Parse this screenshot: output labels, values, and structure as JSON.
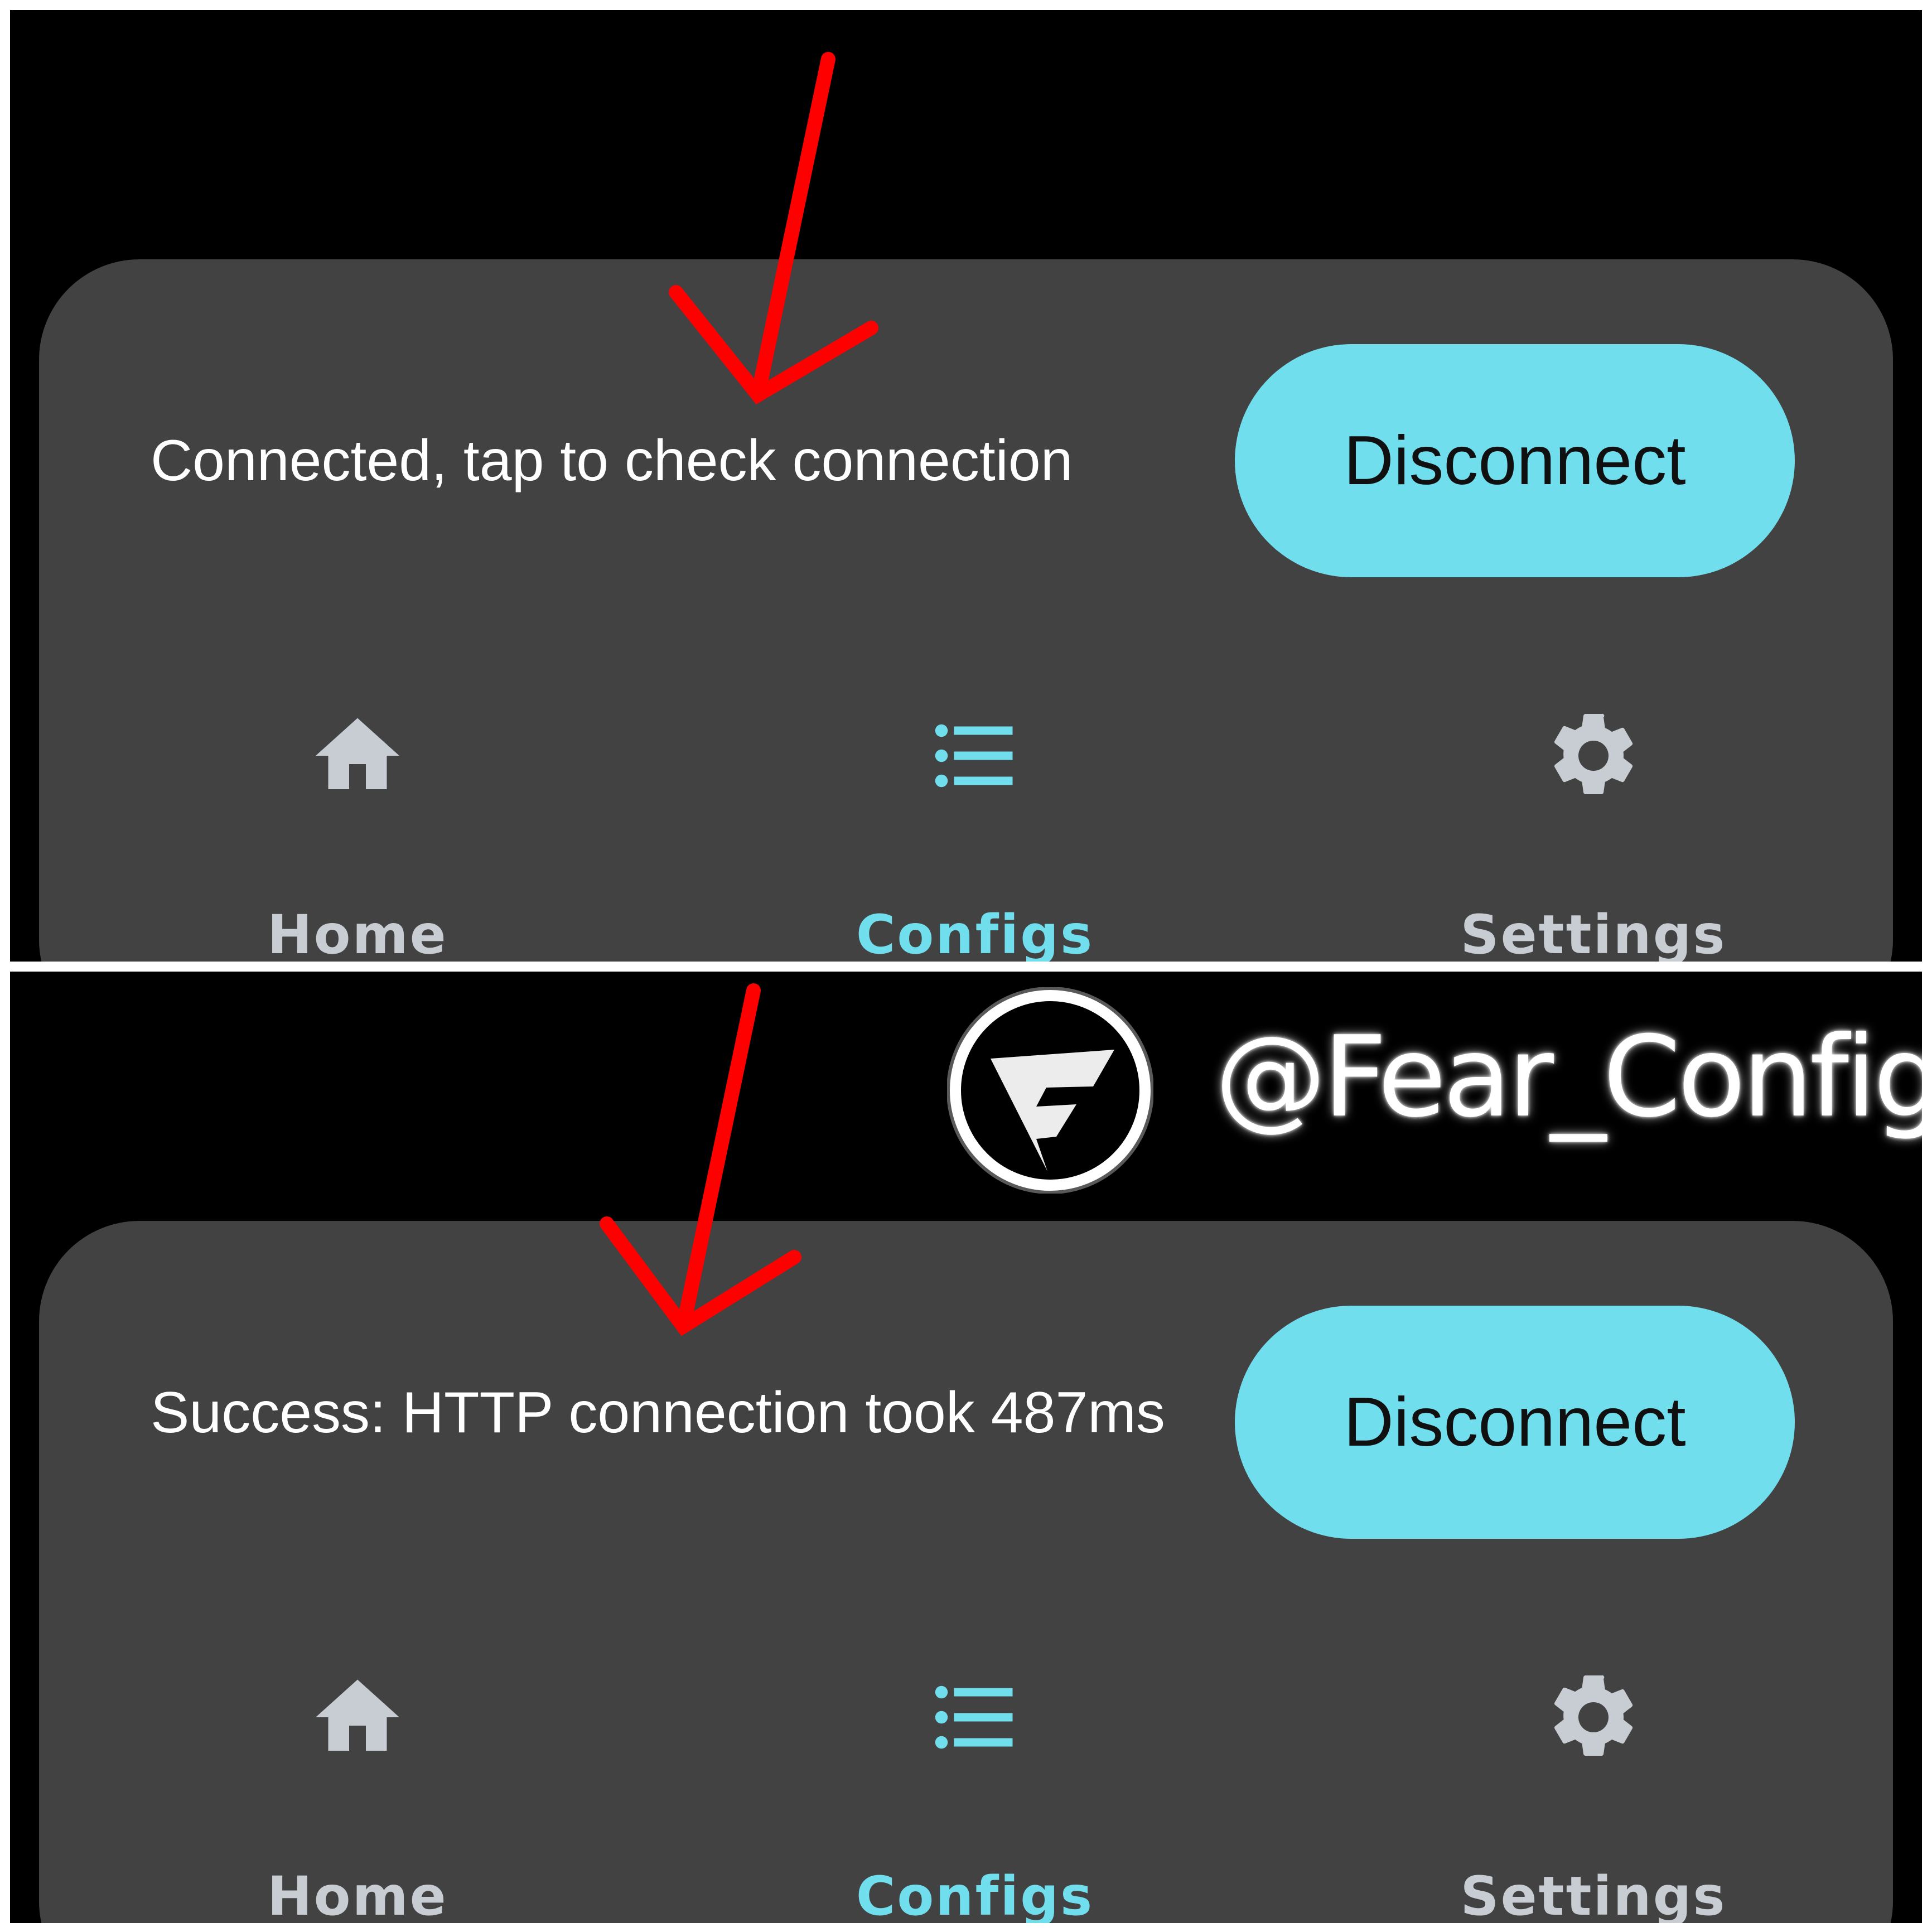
{
  "panels": [
    {
      "status_text": "Connected, tap to check connection",
      "button_label": "Disconnect",
      "nav": [
        {
          "label": "Home",
          "icon": "home-icon",
          "active": false
        },
        {
          "label": "Configs",
          "icon": "list-icon",
          "active": true
        },
        {
          "label": "Settings",
          "icon": "gear-icon",
          "active": false
        }
      ]
    },
    {
      "status_text": "Success: HTTP connection took 487ms",
      "button_label": "Disconnect",
      "nav": [
        {
          "label": "Home",
          "icon": "home-icon",
          "active": false
        },
        {
          "label": "Configs",
          "icon": "list-icon",
          "active": true
        },
        {
          "label": "Settings",
          "icon": "gear-icon",
          "active": false
        }
      ]
    }
  ],
  "watermark": {
    "handle": "@Fear_Config",
    "logo_letter": "F"
  },
  "colors": {
    "accent": "#71deee",
    "sheet": "#424242",
    "background": "#000000",
    "arrow": "#ff0000",
    "inactive": "#c7cdd2"
  }
}
